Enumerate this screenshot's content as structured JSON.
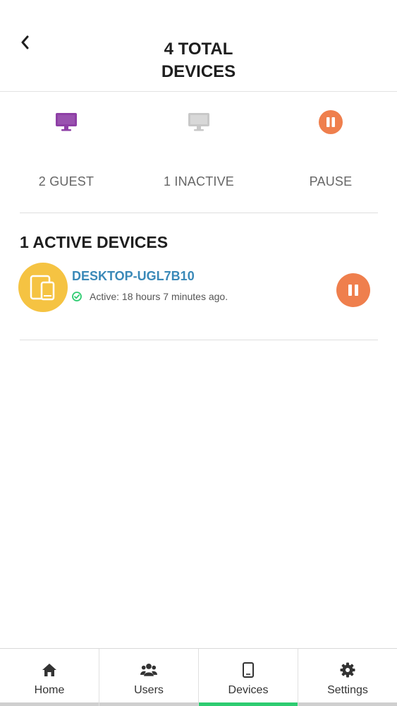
{
  "header": {
    "title_line1": "4 TOTAL",
    "title_line2": "DEVICES"
  },
  "stats": [
    {
      "label": "2 GUEST",
      "icon": "monitor-icon",
      "color": "#8e3fa6"
    },
    {
      "label": "1 INACTIVE",
      "icon": "monitor-icon",
      "color": "#c8c8c8"
    },
    {
      "label": "PAUSE",
      "icon": "pause-icon",
      "color": "#ef7f4d"
    }
  ],
  "section": {
    "title": "1 ACTIVE DEVICES"
  },
  "devices": [
    {
      "name": "DESKTOP-UGL7B10",
      "status": "Active: 18 hours 7 minutes ago.",
      "icon": "devices-icon",
      "avatar_color": "#f5c342",
      "status_color": "#2ecc71"
    }
  ],
  "nav": [
    {
      "label": "Home",
      "icon": "home-icon"
    },
    {
      "label": "Users",
      "icon": "users-icon"
    },
    {
      "label": "Devices",
      "icon": "tablet-icon",
      "active": true
    },
    {
      "label": "Settings",
      "icon": "gear-icon"
    }
  ],
  "colors": {
    "accent_active": "#2ecc71",
    "link": "#3a89b8",
    "pause": "#ef7f4d"
  }
}
